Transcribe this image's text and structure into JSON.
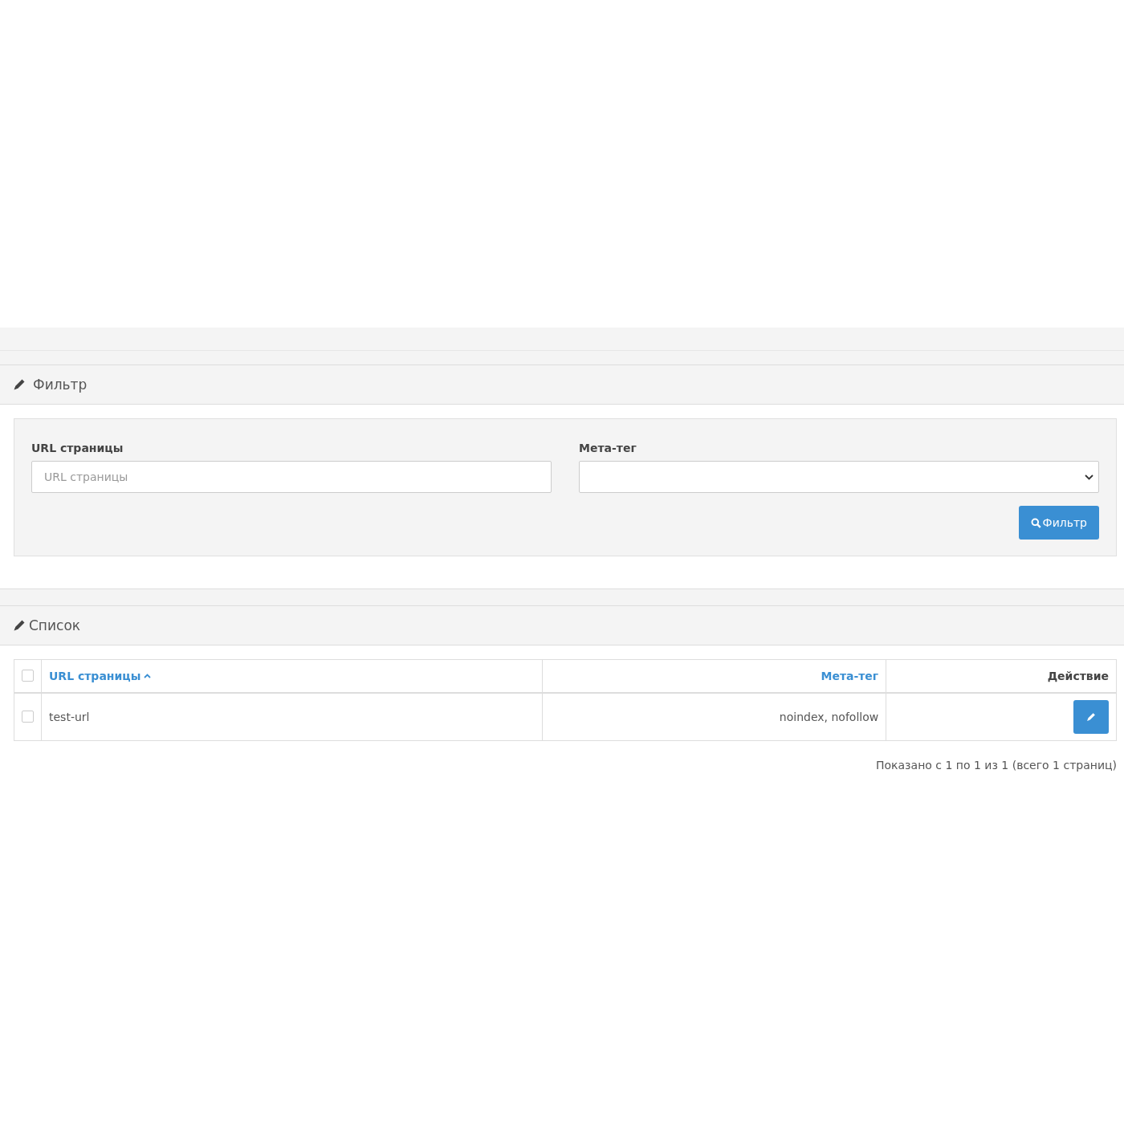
{
  "filter_panel": {
    "title": "Фильтр",
    "fields": [
      {
        "kind": "text",
        "label": "URL страницы",
        "placeholder": "URL страницы"
      },
      {
        "kind": "select",
        "label": "Мета-тег"
      }
    ],
    "button": "Фильтр"
  },
  "list_panel": {
    "title": "Список",
    "table": {
      "select_all_checked": false,
      "columns": [
        {
          "kind": "sort_link",
          "label": "URL страницы",
          "sorted": true
        },
        {
          "kind": "sort_link",
          "label": "Мета-тег",
          "sorted": false
        },
        {
          "kind": "plain",
          "label": "Действие"
        }
      ],
      "rows": [
        {
          "checked": false,
          "url": "test-url",
          "meta_tag": "noindex, nofollow"
        }
      ]
    },
    "pagination_info": "Показано с 1 по 1 из 1 (всего 1 страниц)"
  }
}
